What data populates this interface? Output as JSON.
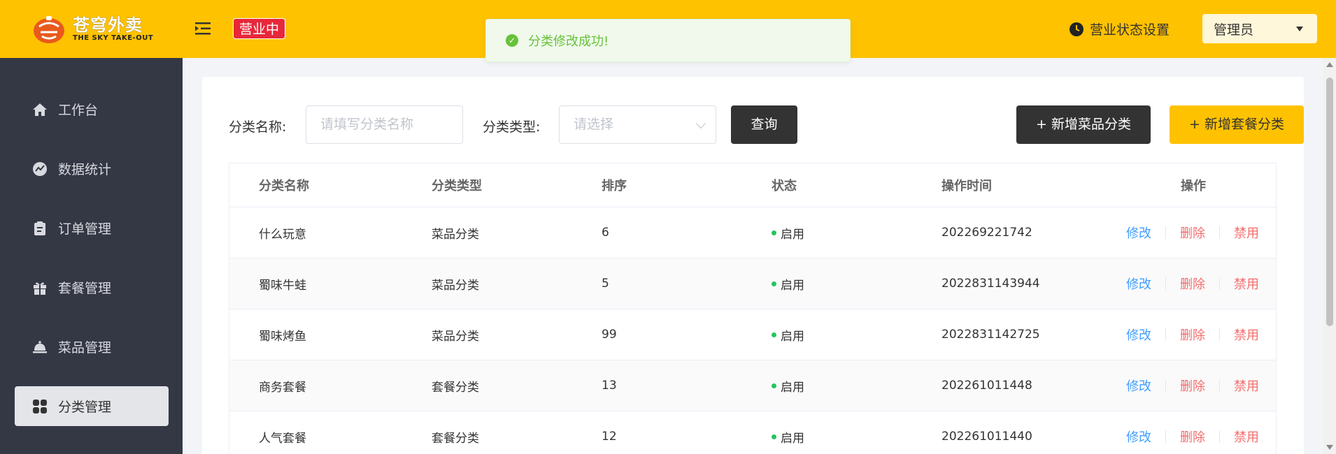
{
  "header": {
    "logo_cn": "苍穹外卖",
    "logo_en": "THE SKY TAKE-OUT",
    "business_status": "营业中",
    "business_setting": "营业状态设置",
    "user": "管理员"
  },
  "toast": {
    "message": "分类修改成功!"
  },
  "sidebar": {
    "items": [
      {
        "label": "工作台",
        "icon": "home-icon"
      },
      {
        "label": "数据统计",
        "icon": "chart-icon"
      },
      {
        "label": "订单管理",
        "icon": "clipboard-icon"
      },
      {
        "label": "套餐管理",
        "icon": "gift-icon"
      },
      {
        "label": "菜品管理",
        "icon": "cloche-icon"
      },
      {
        "label": "分类管理",
        "icon": "grid-icon",
        "active": true
      }
    ]
  },
  "filters": {
    "name_label": "分类名称:",
    "name_placeholder": "请填写分类名称",
    "type_label": "分类类型:",
    "type_placeholder": "请选择",
    "query_button": "查询",
    "add_dish_category": "+ 新增菜品分类",
    "add_setmeal_category": "+ 新增套餐分类"
  },
  "table": {
    "headers": [
      "分类名称",
      "分类类型",
      "排序",
      "状态",
      "操作时间",
      "操作"
    ],
    "actions": {
      "edit": "修改",
      "delete": "删除",
      "disable": "禁用"
    },
    "rows": [
      {
        "name": "什么玩意",
        "type": "菜品分类",
        "sort": "6",
        "status": "启用",
        "time": "202269221742"
      },
      {
        "name": "蜀味牛蛙",
        "type": "菜品分类",
        "sort": "5",
        "status": "启用",
        "time": "2022831143944"
      },
      {
        "name": "蜀味烤鱼",
        "type": "菜品分类",
        "sort": "99",
        "status": "启用",
        "time": "2022831142725"
      },
      {
        "name": "商务套餐",
        "type": "套餐分类",
        "sort": "13",
        "status": "启用",
        "time": "202261011448"
      },
      {
        "name": "人气套餐",
        "type": "套餐分类",
        "sort": "12",
        "status": "启用",
        "time": "202261011440"
      }
    ]
  },
  "colors": {
    "brand": "#ffc200",
    "sidebar": "#343744",
    "status_badge": "#e7273a",
    "success": "#67c23a",
    "link": "#409eff",
    "danger": "#f56c6c",
    "enabled_dot": "#22c55e"
  }
}
